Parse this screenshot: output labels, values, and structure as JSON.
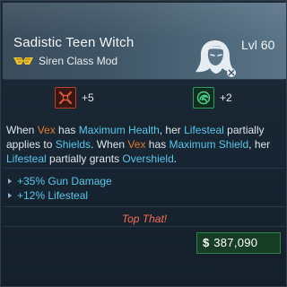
{
  "item": {
    "name": "Sadistic Teen Witch",
    "level_label": "Lvl 60",
    "class_label": "Siren Class Mod"
  },
  "skills": [
    {
      "icon": "crossed-swords-skill-icon",
      "bonus": "+5",
      "color": "#b2402c"
    },
    {
      "icon": "green-swirl-skill-icon",
      "bonus": "+2",
      "color": "#2f9a5e"
    }
  ],
  "description": {
    "p1": "When ",
    "vex1": "Vex",
    "p2": " has ",
    "kw_max_health": "Maximum Health",
    "p3": ", her ",
    "kw_lifesteal1": "Lifesteal",
    "p4": " partially applies to ",
    "kw_shields": "Shields",
    "p5": ". When ",
    "vex2": "Vex",
    "p6": " has ",
    "kw_max_shield": "Maximum Shield",
    "p7": ", her ",
    "kw_lifesteal2": "Lifesteal",
    "p8": " partially grants ",
    "kw_overshield": "Overshield",
    "p9": "."
  },
  "stats": [
    {
      "text": "+35% Gun Damage"
    },
    {
      "text": "+12% Lifesteal"
    }
  ],
  "flavor_text": "Top That!",
  "price": {
    "icon": "$",
    "value": "387,090"
  },
  "colors": {
    "highlight": "#57c7ea",
    "vex_name": "#e07a2b",
    "flavor": "#ff6b57",
    "price_bg": "#173d27"
  }
}
